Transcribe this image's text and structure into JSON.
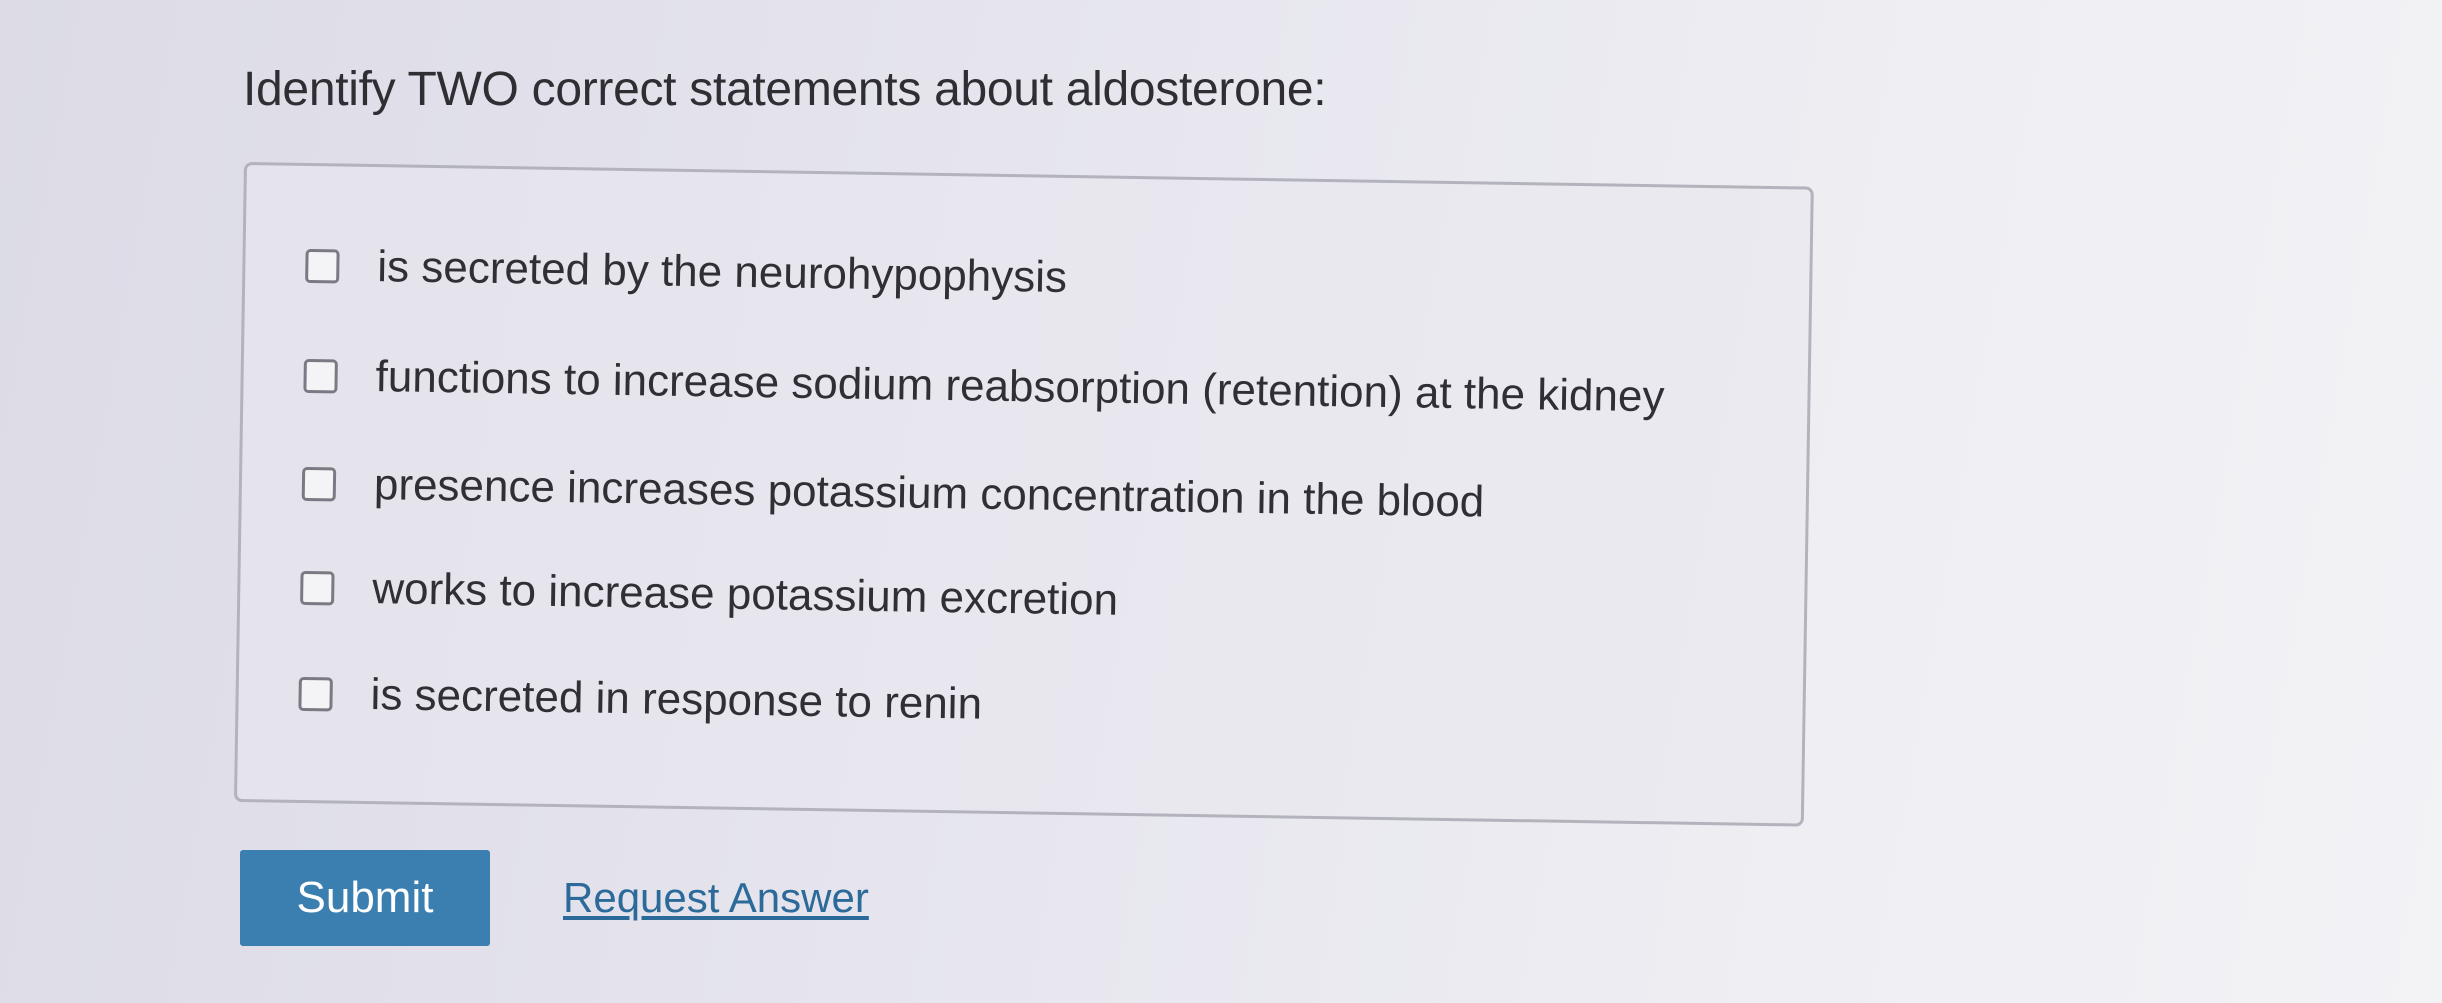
{
  "question": {
    "text": "Identify TWO correct statements about aldosterone:"
  },
  "options": [
    {
      "label": "is secreted by the neurohypophysis",
      "checked": false
    },
    {
      "label": "functions to increase sodium reabsorption (retention) at the kidney",
      "checked": false
    },
    {
      "label": "presence increases potassium concentration in the blood",
      "checked": false
    },
    {
      "label": "works to increase potassium excretion",
      "checked": false
    },
    {
      "label": "is secreted in response to renin",
      "checked": false
    }
  ],
  "actions": {
    "submit_label": "Submit",
    "request_answer_label": "Request Answer"
  },
  "colors": {
    "submit_background": "#3a7fb0",
    "link": "#2c6a99"
  }
}
